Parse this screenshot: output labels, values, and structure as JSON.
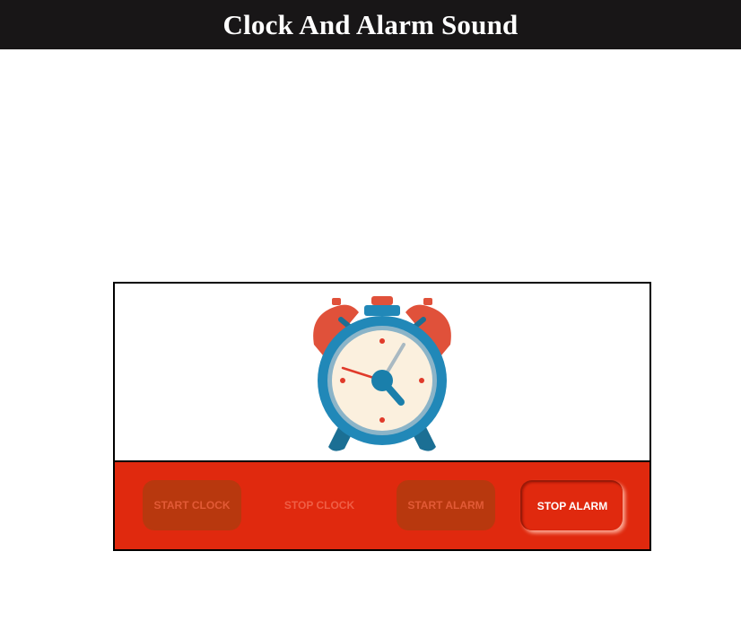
{
  "page": {
    "title": "Clock And Alarm Sound"
  },
  "clock": {
    "icon": "alarm-clock-icon",
    "colors": {
      "bells": "#e0513a",
      "ring": "#2188b8",
      "face": "#fbf0de",
      "hands": "#1a7fab",
      "second_hand": "#e03a2a"
    }
  },
  "controls": {
    "start_clock": "START CLOCK",
    "stop_clock": "STOP CLOCK",
    "start_alarm": "START ALARM",
    "stop_alarm": "STOP ALARM"
  },
  "colors": {
    "header_bg": "#181617",
    "panel_bg": "#e0290e",
    "disabled_button_bg": "#b8380e"
  }
}
